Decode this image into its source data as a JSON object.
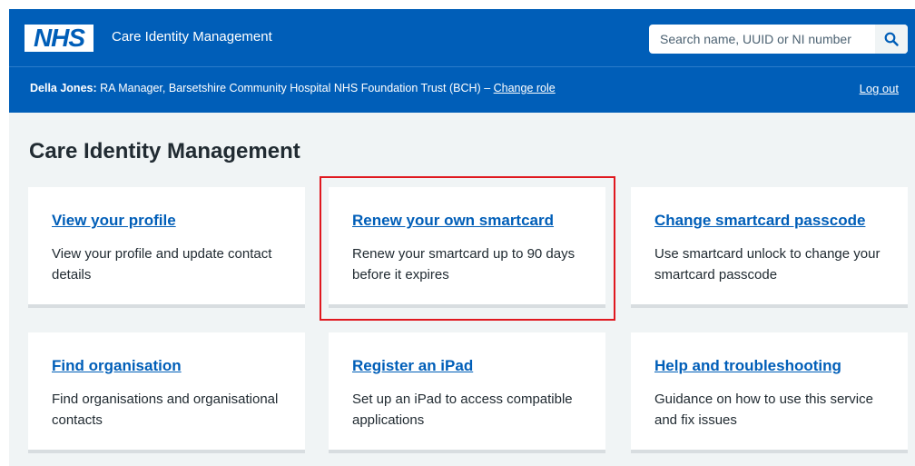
{
  "header": {
    "logo_text": "NHS",
    "service_name": "Care Identity Management",
    "search_placeholder": "Search name, UUID or NI number"
  },
  "user_bar": {
    "name": "Della Jones:",
    "role": " RA Manager, Barsetshire Community Hospital NHS Foundation Trust (BCH) – ",
    "change_role": "Change role",
    "log_out": "Log out"
  },
  "main": {
    "title": "Care Identity Management",
    "cards": [
      {
        "title": "View your profile",
        "description": "View your profile and update contact details"
      },
      {
        "title": "Renew your own smartcard",
        "description": "Renew your smartcard up to 90 days before it expires"
      },
      {
        "title": "Change smartcard passcode",
        "description": "Use smartcard unlock to change your smartcard passcode"
      },
      {
        "title": "Find organisation",
        "description": "Find organisations and organisational contacts"
      },
      {
        "title": "Register an iPad",
        "description": "Set up an iPad to access compatible applications"
      },
      {
        "title": "Help and troubleshooting",
        "description": "Guidance on how to use this service and fix issues"
      }
    ]
  },
  "colors": {
    "nhs_blue": "#005eb8",
    "background": "#f0f4f5",
    "text": "#212b32",
    "highlight": "#e0181f"
  }
}
